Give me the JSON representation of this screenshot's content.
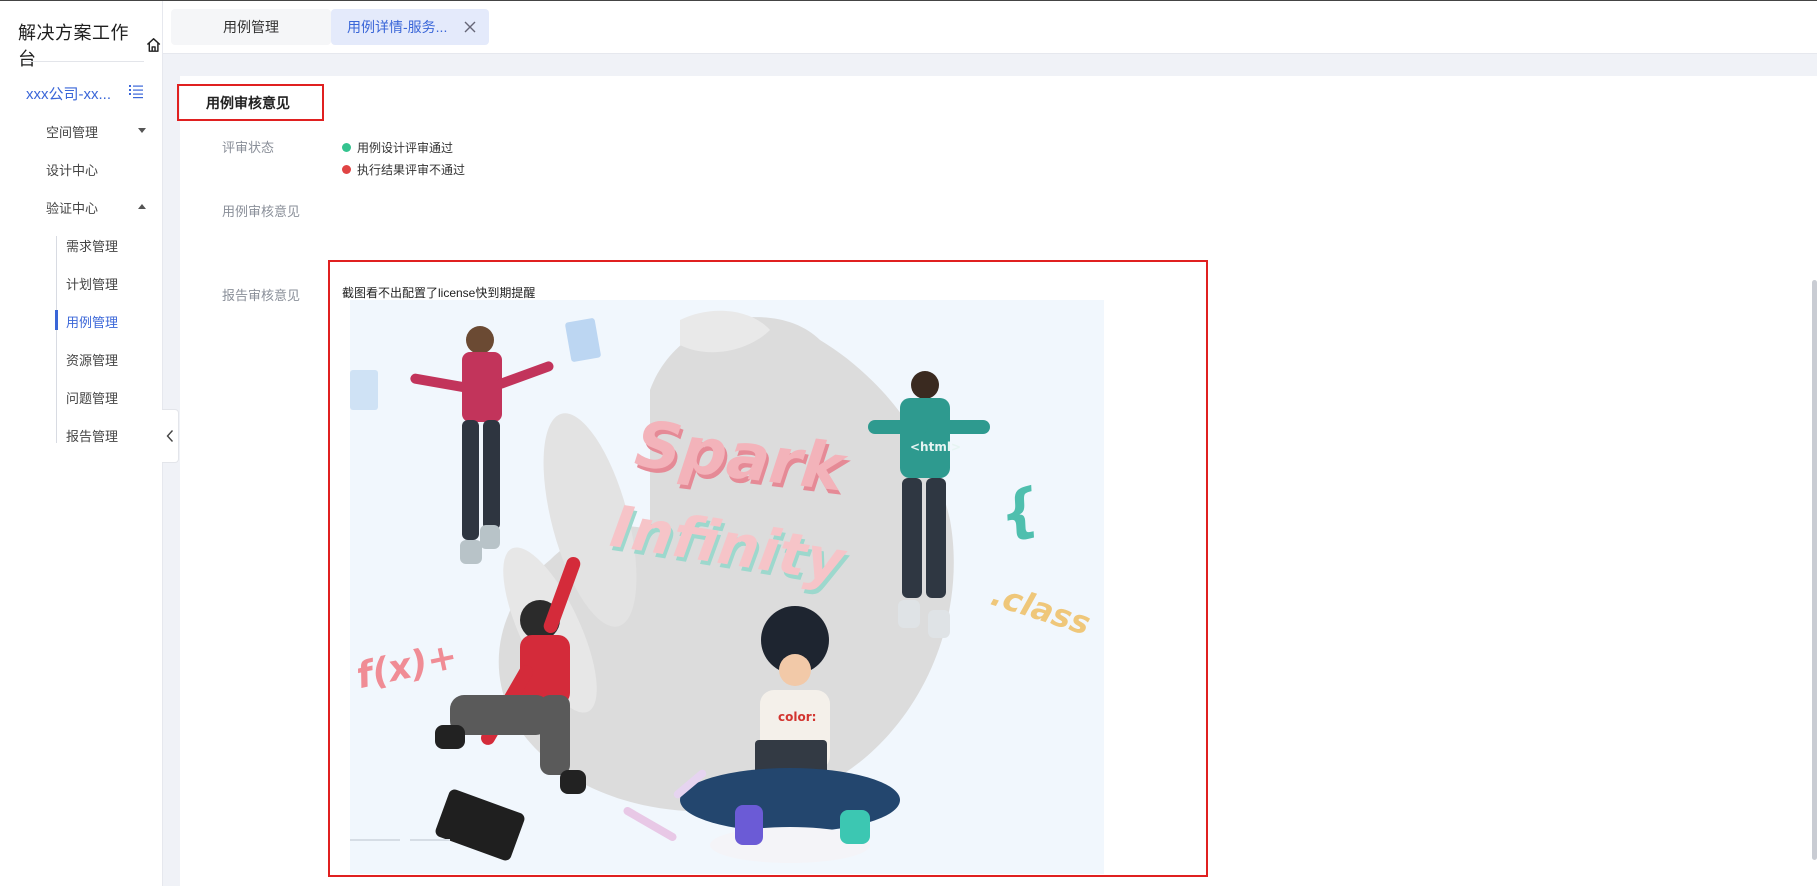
{
  "sidebar": {
    "workspace_title": "解决方案工作台",
    "project_name": "xxx公司-xx...",
    "nav": {
      "space_mgmt": "空间管理",
      "design_center": "设计中心",
      "verify_center": "验证中心"
    },
    "sub_items": {
      "requirement": "需求管理",
      "plan": "计划管理",
      "case": "用例管理",
      "resource": "资源管理",
      "issue": "问题管理",
      "report": "报告管理"
    }
  },
  "tabs": {
    "tab1": "用例管理",
    "tab2": "用例详情-服务..."
  },
  "review": {
    "section_title": "用例审核意见",
    "status_label": "评审状态",
    "status_items": [
      {
        "text": "用例设计评审通过",
        "color": "#34c38f"
      },
      {
        "text": "执行结果评审不通过",
        "color": "#e04444"
      }
    ],
    "case_opinion_label": "用例审核意见",
    "report_opinion_label": "报告审核意见",
    "report_opinion_text": "截图看不出配置了license快到期提醒"
  },
  "illustration": {
    "texts": {
      "spark": "Spark",
      "infinity": "Infinity",
      "class": ".class",
      "fx": "f(x)+",
      "brace": "{",
      "html": "<html>",
      "color": "color:"
    }
  },
  "colors": {
    "accent": "#3a66d8",
    "highlight_border": "#e02020"
  }
}
